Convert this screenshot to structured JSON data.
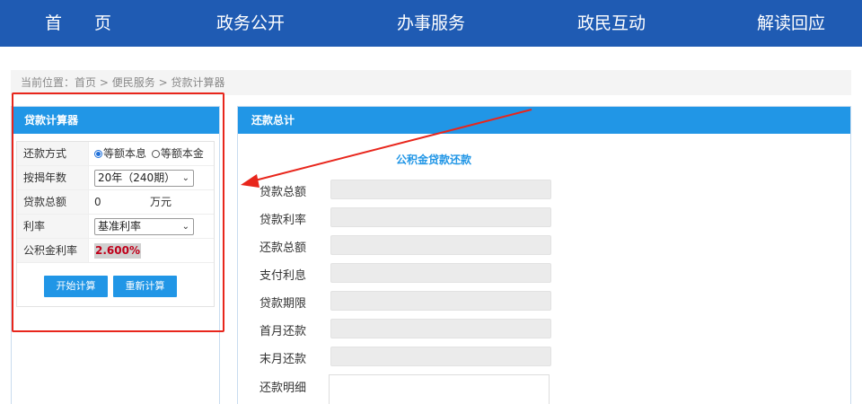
{
  "nav": {
    "items": [
      "首 页",
      "政务公开",
      "办事服务",
      "政民互动",
      "解读回应"
    ]
  },
  "breadcrumb": {
    "prefix": "当前位置：",
    "items": [
      "首页",
      "便民服务",
      "贷款计算器"
    ],
    "separator": ">"
  },
  "calculator": {
    "title": "贷款计算器",
    "rows": {
      "repay_method_label": "还款方式",
      "repay_options": [
        "等额本息",
        "等额本金"
      ],
      "years_label": "按揭年数",
      "years_value": "20年（240期）",
      "amount_label": "贷款总额",
      "amount_value": "0",
      "amount_unit": "万元",
      "rate_label": "利率",
      "rate_value": "基准利率",
      "fund_rate_label": "公积金利率",
      "fund_rate_value": "2.600%"
    },
    "start_button": "开始计算",
    "reset_button": "重新计算"
  },
  "result": {
    "title": "还款总计",
    "subtitle": "公积金贷款还款",
    "fields": [
      "贷款总额",
      "贷款利率",
      "还款总额",
      "支付利息",
      "贷款期限",
      "首月还款",
      "末月还款"
    ],
    "detail_label": "还款明细"
  },
  "colors": {
    "nav_bg": "#1f5bb3",
    "panel_head": "#2196e6",
    "highlight": "#e8261c",
    "rate_text": "#c0001a"
  }
}
